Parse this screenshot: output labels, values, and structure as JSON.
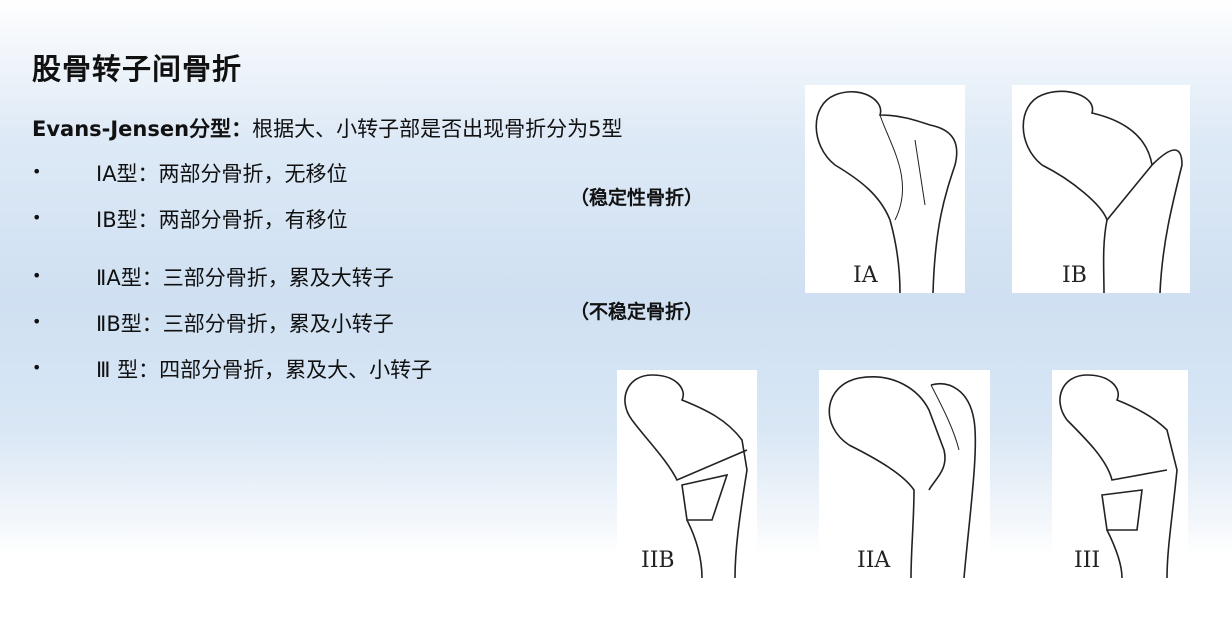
{
  "title": "股骨转子间骨折",
  "subtitle": {
    "bold": "Evans-Jensen分型：",
    "text": "根据大、小转子部是否出现骨折分为5型"
  },
  "items": [
    {
      "bullet": "•",
      "text": "ⅠA型：两部分骨折，无移位"
    },
    {
      "bullet": "•",
      "text": "ⅠB型：两部分骨折，有移位"
    },
    {
      "bullet": "•",
      "text": "ⅡA型：三部分骨折，累及大转子"
    },
    {
      "bullet": "•",
      "text": "ⅡB型：三部分骨折，累及小转子"
    },
    {
      "bullet": "•",
      "text": "Ⅲ 型：四部分骨折，累及大、小转子"
    }
  ],
  "notes": {
    "stable": "（稳定性骨折）",
    "unstable": "（不稳定骨折）"
  },
  "figures": [
    {
      "label": "IA"
    },
    {
      "label": "IB"
    },
    {
      "label": "IIB"
    },
    {
      "label": "IIA"
    },
    {
      "label": "III"
    }
  ]
}
